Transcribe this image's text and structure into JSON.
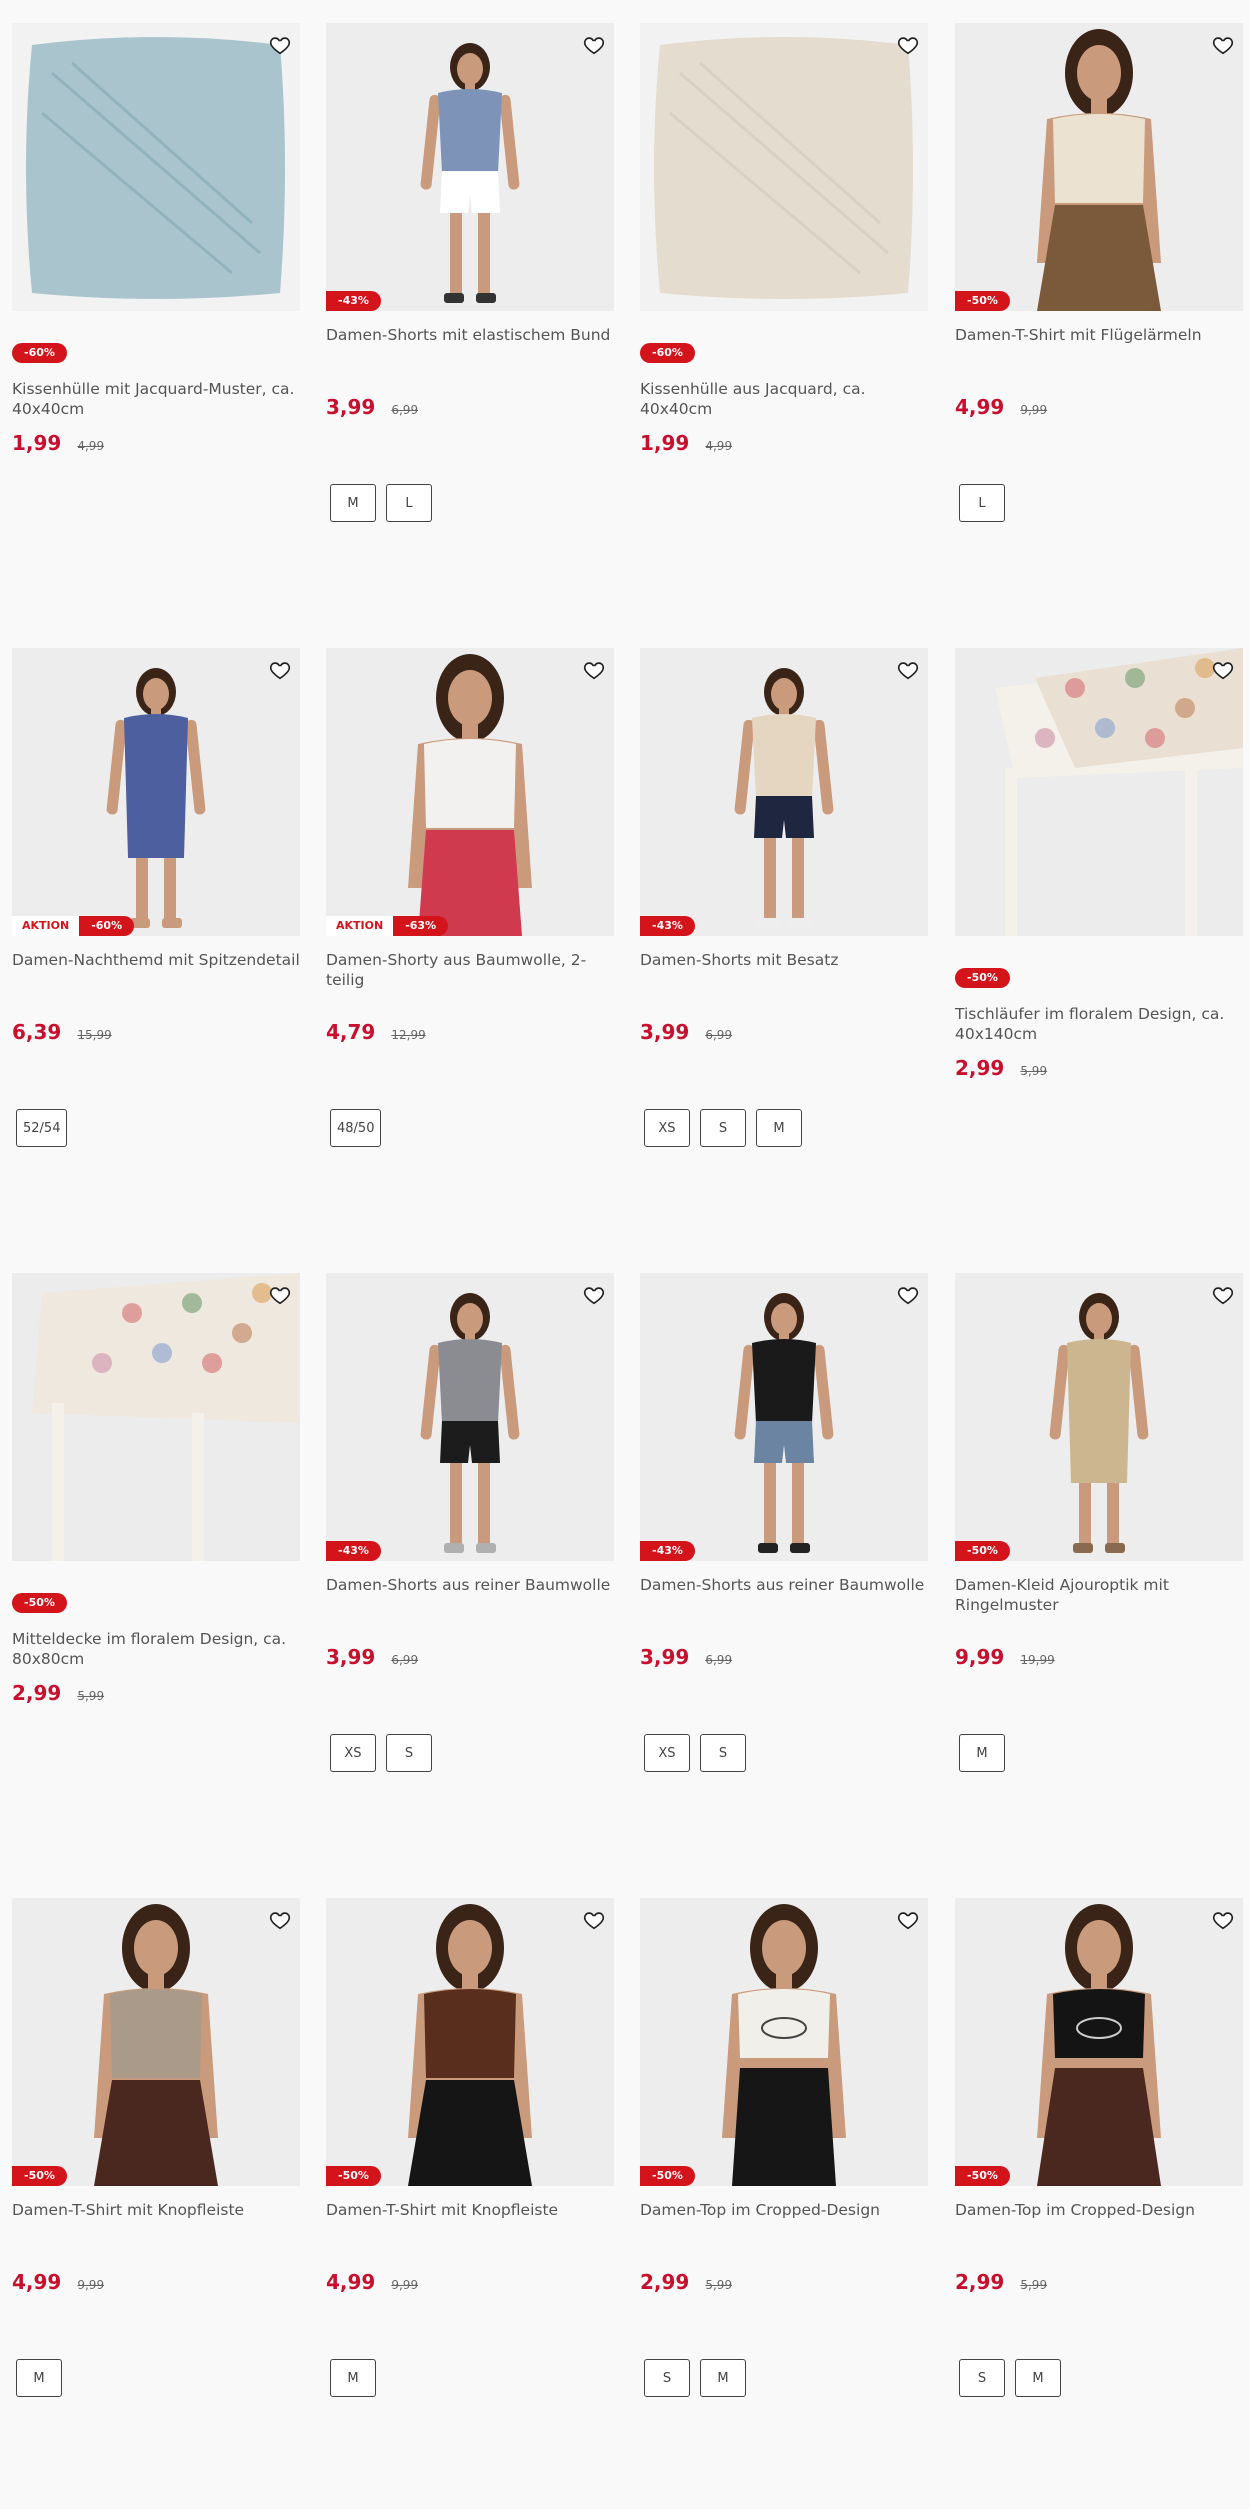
{
  "colors": {
    "accent": "#c8102e",
    "badge": "#d4141b"
  },
  "products": [
    {
      "image": "blue-jacquard-cushion-cover",
      "discount": "-60%",
      "aktion": "",
      "badge_on_image": false,
      "title": "Kissenhülle mit Jacquard-Muster, ca. 40x40cm",
      "price": "1,99",
      "old_price": "4,99",
      "sizes": []
    },
    {
      "image": "woman-blue-shirt-white-shorts",
      "discount": "-43%",
      "aktion": "",
      "badge_on_image": true,
      "title": "Damen-Shorts mit elastischem Bund",
      "price": "3,99",
      "old_price": "6,99",
      "sizes": [
        "M",
        "L"
      ]
    },
    {
      "image": "beige-jacquard-cushion-cover",
      "discount": "-60%",
      "aktion": "",
      "badge_on_image": false,
      "title": "Kissenhülle aus Jacquard, ca. 40x40cm",
      "price": "1,99",
      "old_price": "4,99",
      "sizes": []
    },
    {
      "image": "woman-cream-tshirt-leopard-skirt",
      "discount": "-50%",
      "aktion": "",
      "badge_on_image": true,
      "title": "Damen-T-Shirt mit Flügelärmeln",
      "price": "4,99",
      "old_price": "9,99",
      "sizes": [
        "L"
      ]
    },
    {
      "image": "woman-blue-floral-nightdress",
      "discount": "-60%",
      "aktion": "AKTION",
      "badge_on_image": true,
      "title": "Damen-Nachthemd mit Spitzendetail",
      "price": "6,39",
      "old_price": "15,99",
      "sizes": [
        "52/54"
      ]
    },
    {
      "image": "woman-white-tshirt-red-shorts",
      "discount": "-63%",
      "aktion": "AKTION",
      "badge_on_image": true,
      "title": "Damen-Shorty aus Baumwolle, 2-teilig",
      "price": "4,79",
      "old_price": "12,99",
      "sizes": [
        "48/50"
      ]
    },
    {
      "image": "woman-striped-top-navy-shorts",
      "discount": "-43%",
      "aktion": "",
      "badge_on_image": true,
      "title": "Damen-Shorts mit Besatz",
      "price": "3,99",
      "old_price": "6,99",
      "sizes": [
        "XS",
        "S",
        "M"
      ]
    },
    {
      "image": "floral-table-runner",
      "discount": "-50%",
      "aktion": "",
      "badge_on_image": false,
      "title": "Tischläufer im floralem Design, ca. 40x140cm",
      "price": "2,99",
      "old_price": "5,99",
      "sizes": []
    },
    {
      "image": "floral-table-cloth",
      "discount": "-50%",
      "aktion": "",
      "badge_on_image": false,
      "title": "Mitteldecke im floralem Design, ca. 80x80cm",
      "price": "2,99",
      "old_price": "5,99",
      "sizes": []
    },
    {
      "image": "woman-grey-top-black-shorts",
      "discount": "-43%",
      "aktion": "",
      "badge_on_image": true,
      "title": "Damen-Shorts aus reiner Baumwolle",
      "price": "3,99",
      "old_price": "6,99",
      "sizes": [
        "XS",
        "S"
      ]
    },
    {
      "image": "woman-black-top-denim-shorts",
      "discount": "-43%",
      "aktion": "",
      "badge_on_image": true,
      "title": "Damen-Shorts aus reiner Baumwolle",
      "price": "3,99",
      "old_price": "6,99",
      "sizes": [
        "XS",
        "S"
      ]
    },
    {
      "image": "woman-striped-knit-dress",
      "discount": "-50%",
      "aktion": "",
      "badge_on_image": true,
      "title": "Damen-Kleid Ajouroptik mit Ringelmuster",
      "price": "9,99",
      "old_price": "19,99",
      "sizes": [
        "M"
      ]
    },
    {
      "image": "woman-taupe-tshirt-tiered-skirt",
      "discount": "-50%",
      "aktion": "",
      "badge_on_image": true,
      "title": "Damen-T-Shirt mit Knopfleiste",
      "price": "4,99",
      "old_price": "9,99",
      "sizes": [
        "M"
      ]
    },
    {
      "image": "woman-brown-tshirt-black-skirt",
      "discount": "-50%",
      "aktion": "",
      "badge_on_image": true,
      "title": "Damen-T-Shirt mit Knopfleiste",
      "price": "4,99",
      "old_price": "9,99",
      "sizes": [
        "M"
      ]
    },
    {
      "image": "woman-white-crop-top-black-pants",
      "discount": "-50%",
      "aktion": "",
      "badge_on_image": true,
      "title": "Damen-Top im Cropped-Design",
      "price": "2,99",
      "old_price": "5,99",
      "sizes": [
        "S",
        "M"
      ]
    },
    {
      "image": "woman-black-crop-top-tiered-skirt",
      "discount": "-50%",
      "aktion": "",
      "badge_on_image": true,
      "title": "Damen-Top im Cropped-Design",
      "price": "2,99",
      "old_price": "5,99",
      "sizes": [
        "S",
        "M"
      ]
    }
  ]
}
